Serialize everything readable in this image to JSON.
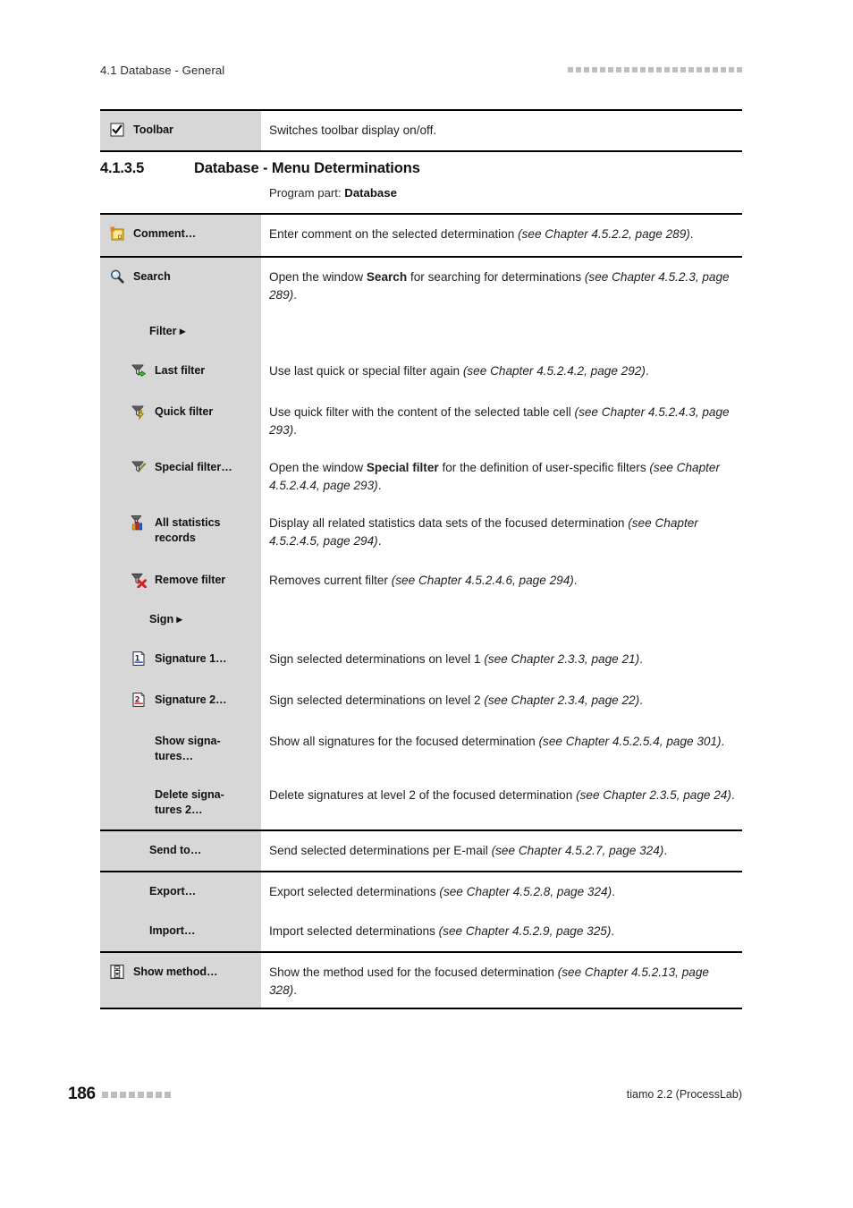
{
  "header": {
    "running_title": "4.1 Database - General",
    "square_count": 22,
    "square_color": "#bfbfbf"
  },
  "top_table": {
    "rows": [
      {
        "icon": "checkbox-checked-icon",
        "label": "Toolbar",
        "description_plain": "Switches toolbar display on/off.",
        "description_html": "Switches toolbar display on/off."
      }
    ]
  },
  "section": {
    "number": "4.1.3.5",
    "title": "Database - Menu Determinations",
    "program_part_label": "Program part:",
    "program_part_value": "Database"
  },
  "menu_table": {
    "rows": [
      {
        "group": 1,
        "indent": 0,
        "icon": "comment-note-icon",
        "label": "Comment…",
        "description_html": "Enter comment on the selected determination <i>(see Chapter 4.5.2.2, page 289)</i>."
      },
      {
        "group": 2,
        "indent": 0,
        "icon": "magnifier-search-icon",
        "label": "Search",
        "description_html": "Open the window <b>Search</b> for searching for determinations <i>(see Chapter 4.5.2.3, page 289)</i>."
      },
      {
        "group": 2,
        "indent": 1,
        "icon": "none",
        "label": "Filter ▸",
        "description_html": ""
      },
      {
        "group": 2,
        "indent": 2,
        "icon": "filter-last-icon",
        "label": "Last filter",
        "description_html": "Use last quick or special filter again <i>(see Chapter 4.5.2.4.2, page 292)</i>."
      },
      {
        "group": 2,
        "indent": 2,
        "icon": "filter-quick-icon",
        "label": "Quick filter",
        "description_html": "Use quick filter with the content of the selected table cell <i>(see Chapter 4.5.2.4.3, page 293)</i>."
      },
      {
        "group": 2,
        "indent": 2,
        "icon": "filter-special-icon",
        "label": "Special filter…",
        "description_html": "Open the window <b>Special filter</b> for the definition of user-specific filters <i>(see Chapter 4.5.2.4.4, page 293)</i>."
      },
      {
        "group": 2,
        "indent": 2,
        "icon": "filter-statistics-icon",
        "label": "All statistics records",
        "description_html": "Display all related statistics data sets of the focused determination <i>(see Chapter 4.5.2.4.5, page 294)</i>."
      },
      {
        "group": 2,
        "indent": 2,
        "icon": "filter-remove-icon",
        "label": "Remove filter",
        "description_html": "Removes current filter <i>(see Chapter 4.5.2.4.6, page 294)</i>."
      },
      {
        "group": 2,
        "indent": 1,
        "icon": "none",
        "label": "Sign ▸",
        "description_html": ""
      },
      {
        "group": 2,
        "indent": 2,
        "icon": "signature-1-icon",
        "label": "Signature 1…",
        "description_html": "Sign selected determinations on level 1 <i>(see Chapter 2.3.3, page 21)</i>."
      },
      {
        "group": 2,
        "indent": 2,
        "icon": "signature-2-icon",
        "label": "Signature 2…",
        "description_html": "Sign selected determinations on level 2 <i>(see Chapter 2.3.4, page 22)</i>."
      },
      {
        "group": 2,
        "indent": 2,
        "icon": "none",
        "label": "Show signa-\ntures…",
        "description_html": "Show all signatures for the focused determination <i>(see Chapter 4.5.2.5.4, page 301)</i>."
      },
      {
        "group": 2,
        "indent": 2,
        "icon": "none",
        "label": "Delete signa-\ntures 2…",
        "description_html": "Delete signatures at level 2 of the focused determination <i>(see Chapter 2.3.5, page 24)</i>."
      },
      {
        "group": 3,
        "indent": 1,
        "icon": "none",
        "label": "Send to…",
        "description_html": "Send selected determinations per E-mail <i>(see Chapter 4.5.2.7, page 324)</i>."
      },
      {
        "group": 4,
        "indent": 1,
        "icon": "none",
        "label": "Export…",
        "description_html": "Export selected determinations <i>(see Chapter 4.5.2.8, page 324)</i>."
      },
      {
        "group": 4,
        "indent": 1,
        "icon": "none",
        "label": "Import…",
        "description_html": "Import selected determinations <i>(see Chapter 4.5.2.9, page 325)</i>."
      },
      {
        "group": 5,
        "indent": 0,
        "icon": "show-method-icon",
        "label": "Show method…",
        "description_html": "Show the method used for the focused determination <i>(see Chapter 4.5.2.13, page 328)</i>."
      }
    ]
  },
  "footer": {
    "page_number": "186",
    "square_count": 8,
    "product": "tiamo 2.2 (ProcessLab)"
  },
  "colors": {
    "label_column_bg": "#d7d7d7",
    "rule": "#000000",
    "page_bg": "#ffffff",
    "text": "#1f1f1f"
  }
}
